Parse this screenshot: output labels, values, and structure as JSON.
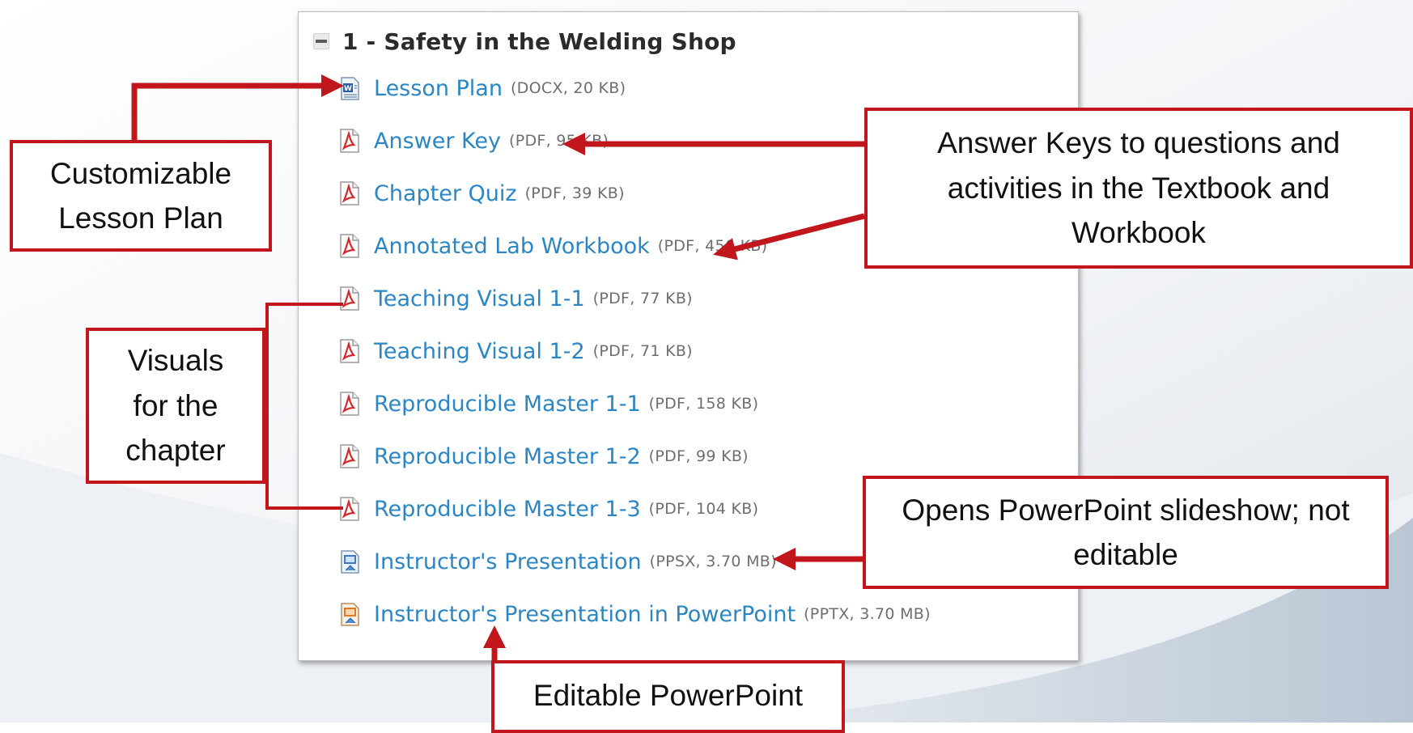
{
  "section": {
    "title": "1 - Safety in the Welding Shop",
    "collapse_icon": "minus-square-icon"
  },
  "files": [
    {
      "name": "Lesson Plan",
      "meta": "(DOCX, 20 KB)",
      "icon": "word-doc-icon"
    },
    {
      "name": "Answer Key",
      "meta": "(PDF, 95 KB)",
      "icon": "pdf-icon"
    },
    {
      "name": "Chapter Quiz",
      "meta": "(PDF, 39 KB)",
      "icon": "pdf-icon"
    },
    {
      "name": "Annotated Lab Workbook",
      "meta": "(PDF, 456 KB)",
      "icon": "pdf-icon"
    },
    {
      "name": "Teaching Visual 1-1",
      "meta": "(PDF, 77 KB)",
      "icon": "pdf-icon"
    },
    {
      "name": "Teaching Visual 1-2",
      "meta": "(PDF, 71 KB)",
      "icon": "pdf-icon"
    },
    {
      "name": "Reproducible Master 1-1",
      "meta": "(PDF, 158 KB)",
      "icon": "pdf-icon"
    },
    {
      "name": "Reproducible Master 1-2",
      "meta": "(PDF, 99 KB)",
      "icon": "pdf-icon"
    },
    {
      "name": "Reproducible Master 1-3",
      "meta": "(PDF, 104 KB)",
      "icon": "pdf-icon"
    },
    {
      "name": "Instructor's Presentation",
      "meta": "(PPSX, 3.70 MB)",
      "icon": "powerpoint-show-icon"
    },
    {
      "name": "Instructor's Presentation in PowerPoint",
      "meta": "(PPTX, 3.70 MB)",
      "icon": "powerpoint-icon"
    }
  ],
  "callouts": {
    "lesson_plan": "Customizable Lesson Plan",
    "answer_keys": "Answer Keys to questions and activities in the Textbook and Workbook",
    "visuals": "Visuals for the chapter",
    "ppsx": "Opens PowerPoint slideshow; not editable",
    "pptx": "Editable PowerPoint"
  },
  "colors": {
    "link": "#2a86c5",
    "callout_border": "#c0161c",
    "arrow": "#c0161c",
    "meta_text": "#6e6e6e",
    "pdf_red": "#d8282b"
  }
}
